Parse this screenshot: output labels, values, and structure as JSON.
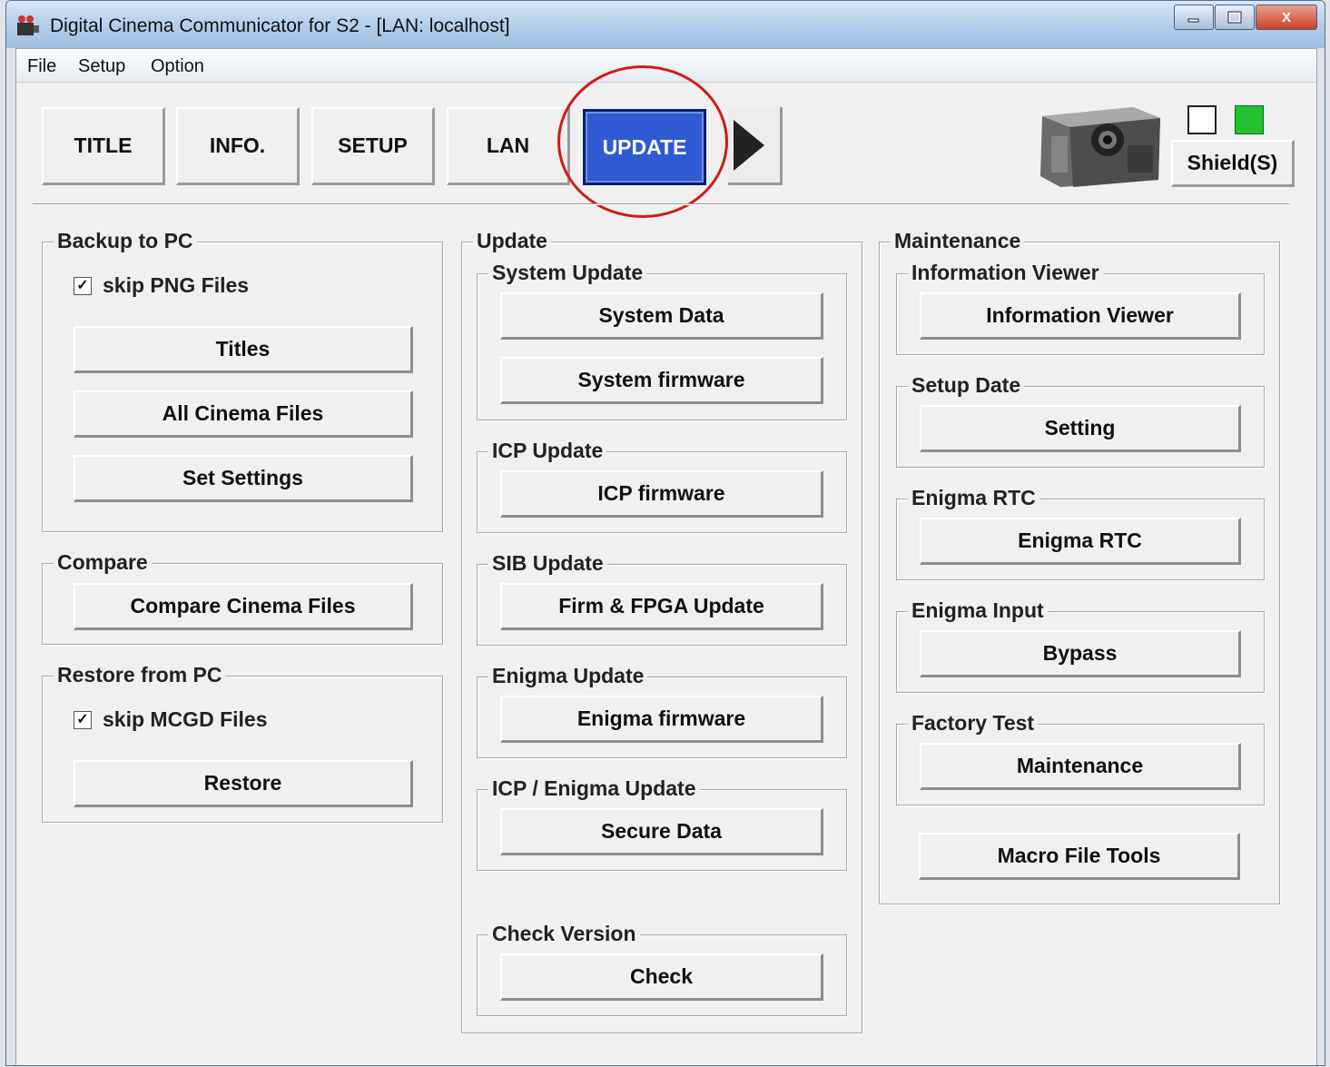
{
  "window": {
    "title": "Digital Cinema Communicator for S2 - [LAN: localhost]",
    "minimize_icon": "minimize-icon",
    "maximize_icon": "maximize-icon",
    "close_icon": "close-icon",
    "close_glyph": "X"
  },
  "menu": {
    "file": "File",
    "setup": "Setup",
    "option": "Option"
  },
  "tabs": {
    "title": "TITLE",
    "info": "INFO.",
    "setup": "SETUP",
    "lan": "LAN",
    "update": "UPDATE",
    "active": "UPDATE"
  },
  "status": {
    "indicator1_color": "#ffffff",
    "indicator2_color": "#22c32e",
    "shield": "Shield(S)"
  },
  "backup": {
    "legend": "Backup to PC",
    "skip_png": "skip PNG Files",
    "skip_png_checked": true,
    "titles": "Titles",
    "all_cinema_files": "All Cinema Files",
    "set_settings": "Set Settings"
  },
  "compare": {
    "legend": "Compare",
    "compare_cinema_files": "Compare Cinema Files"
  },
  "restore": {
    "legend": "Restore from PC",
    "skip_mcgd": "skip MCGD Files",
    "skip_mcgd_checked": true,
    "restore": "Restore"
  },
  "update": {
    "legend": "Update",
    "system_update": {
      "legend": "System Update",
      "system_data": "System Data",
      "system_firmware": "System firmware"
    },
    "icp_update": {
      "legend": "ICP Update",
      "icp_firmware": "ICP firmware"
    },
    "sib_update": {
      "legend": "SIB Update",
      "firm_fpga": "Firm & FPGA Update"
    },
    "enigma_update": {
      "legend": "Enigma Update",
      "enigma_firmware": "Enigma firmware"
    },
    "icp_enigma_update": {
      "legend": "ICP / Enigma Update",
      "secure_data": "Secure Data"
    },
    "check_version": {
      "legend": "Check Version",
      "check": "Check"
    }
  },
  "maintenance": {
    "legend": "Maintenance",
    "information_viewer": {
      "legend": "Information Viewer",
      "button": "Information Viewer"
    },
    "setup_date": {
      "legend": "Setup Date",
      "button": "Setting"
    },
    "enigma_rtc": {
      "legend": "Enigma RTC",
      "button": "Enigma RTC"
    },
    "enigma_input": {
      "legend": "Enigma Input",
      "button": "Bypass"
    },
    "factory_test": {
      "legend": "Factory Test",
      "button": "Maintenance"
    },
    "macro_file_tools": "Macro File Tools"
  },
  "highlight_color": "#d11a1a"
}
